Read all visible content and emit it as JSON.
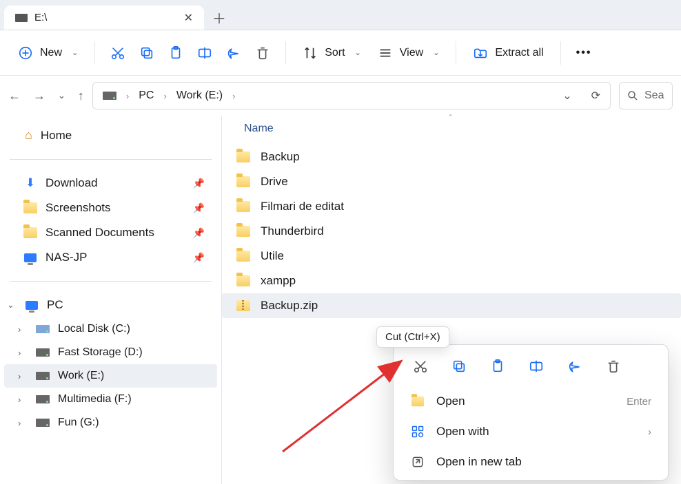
{
  "tab": {
    "title": "E:\\"
  },
  "toolbar": {
    "new_label": "New",
    "sort_label": "Sort",
    "view_label": "View",
    "extract_label": "Extract all"
  },
  "breadcrumb": {
    "items": [
      "PC",
      "Work (E:)"
    ]
  },
  "search": {
    "placeholder": "Sea"
  },
  "sidebar": {
    "home_label": "Home",
    "quick": [
      {
        "label": "Download",
        "icon": "download"
      },
      {
        "label": "Screenshots",
        "icon": "folder"
      },
      {
        "label": "Scanned Documents",
        "icon": "folder"
      },
      {
        "label": "NAS-JP",
        "icon": "monitor"
      }
    ],
    "pc_label": "PC",
    "drives": [
      {
        "label": "Local Disk (C:)",
        "selected": false
      },
      {
        "label": "Fast Storage (D:)",
        "selected": false
      },
      {
        "label": "Work (E:)",
        "selected": true
      },
      {
        "label": "Multimedia (F:)",
        "selected": false
      },
      {
        "label": "Fun (G:)",
        "selected": false
      }
    ]
  },
  "filelist": {
    "column_name": "Name",
    "items": [
      {
        "name": "Backup",
        "type": "folder",
        "selected": false
      },
      {
        "name": "Drive",
        "type": "drive-folder",
        "selected": false
      },
      {
        "name": "Filmari de editat",
        "type": "folder",
        "selected": false
      },
      {
        "name": "Thunderbird",
        "type": "folder",
        "selected": false
      },
      {
        "name": "Utile",
        "type": "folder",
        "selected": false
      },
      {
        "name": "xampp",
        "type": "folder",
        "selected": false
      },
      {
        "name": "Backup.zip",
        "type": "zip",
        "selected": true
      }
    ]
  },
  "tooltip": {
    "text": "Cut (Ctrl+X)"
  },
  "contextmenu": {
    "items": [
      {
        "label": "Open",
        "hint": "Enter",
        "icon": "folder"
      },
      {
        "label": "Open with",
        "submenu": true,
        "icon": "openwith"
      },
      {
        "label": "Open in new tab",
        "icon": "newtab"
      }
    ]
  }
}
